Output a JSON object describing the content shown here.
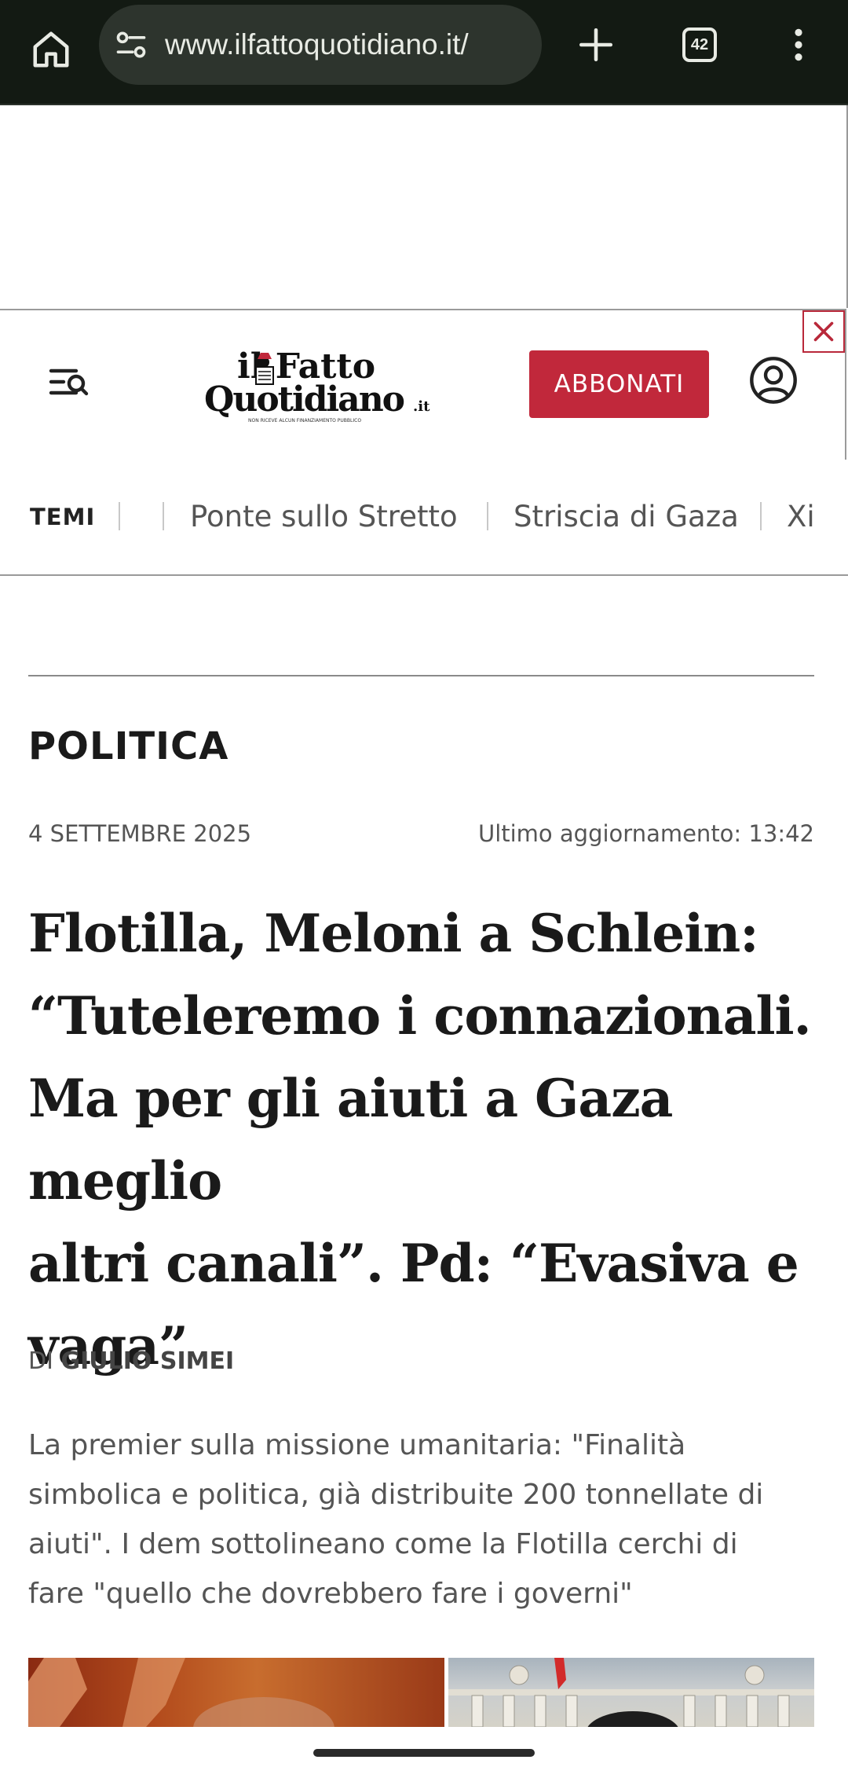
{
  "browser": {
    "url": "www.ilfattoquotidiano.it/",
    "tab_count": "42",
    "home_icon": "home-icon",
    "site_info_icon": "tune-icon",
    "new_tab_icon": "plus-icon",
    "menu_icon": "more-vert-icon",
    "background_color": "#131a13"
  },
  "header": {
    "logo_text_top": "il Fatto",
    "logo_text_bottom": "Quotidiano",
    "logo_suffix": ".it",
    "logo_tagline": "NON RICEVE ALCUN FINANZIAMENTO PUBBLICO",
    "subscribe_label": "ABBONATI",
    "subscribe_color": "#c1283b",
    "menu_icon": "menu-search-icon",
    "user_icon": "user-icon",
    "close_icon": "close-icon"
  },
  "topics": {
    "label": "TEMI",
    "items": [
      "Ponte sullo Stretto",
      "Striscia di Gaza",
      "Xi"
    ]
  },
  "article": {
    "section": "POLITICA",
    "date": "4 SETTEMBRE 2025",
    "updated": "Ultimo aggiornamento: 13:42",
    "headline_lines": [
      "Flotilla, Meloni a Schlein:",
      "“Tuteleremo i connazionali.",
      "Ma per gli aiuti a Gaza meglio",
      "altri canali”. Pd: “Evasiva e",
      "vaga”"
    ],
    "byline_prefix": "DI",
    "author": "GIULIO SIMEI",
    "summary_lines": [
      "La premier sulla missione umanitaria: \"Finalità",
      "simbolica e politica, già distribuite 200 tonnellate di",
      "aiuti\". I dem sottolineano come la Flotilla cerchi di",
      "fare \"quello che dovrebbero fare i governi\""
    ]
  }
}
